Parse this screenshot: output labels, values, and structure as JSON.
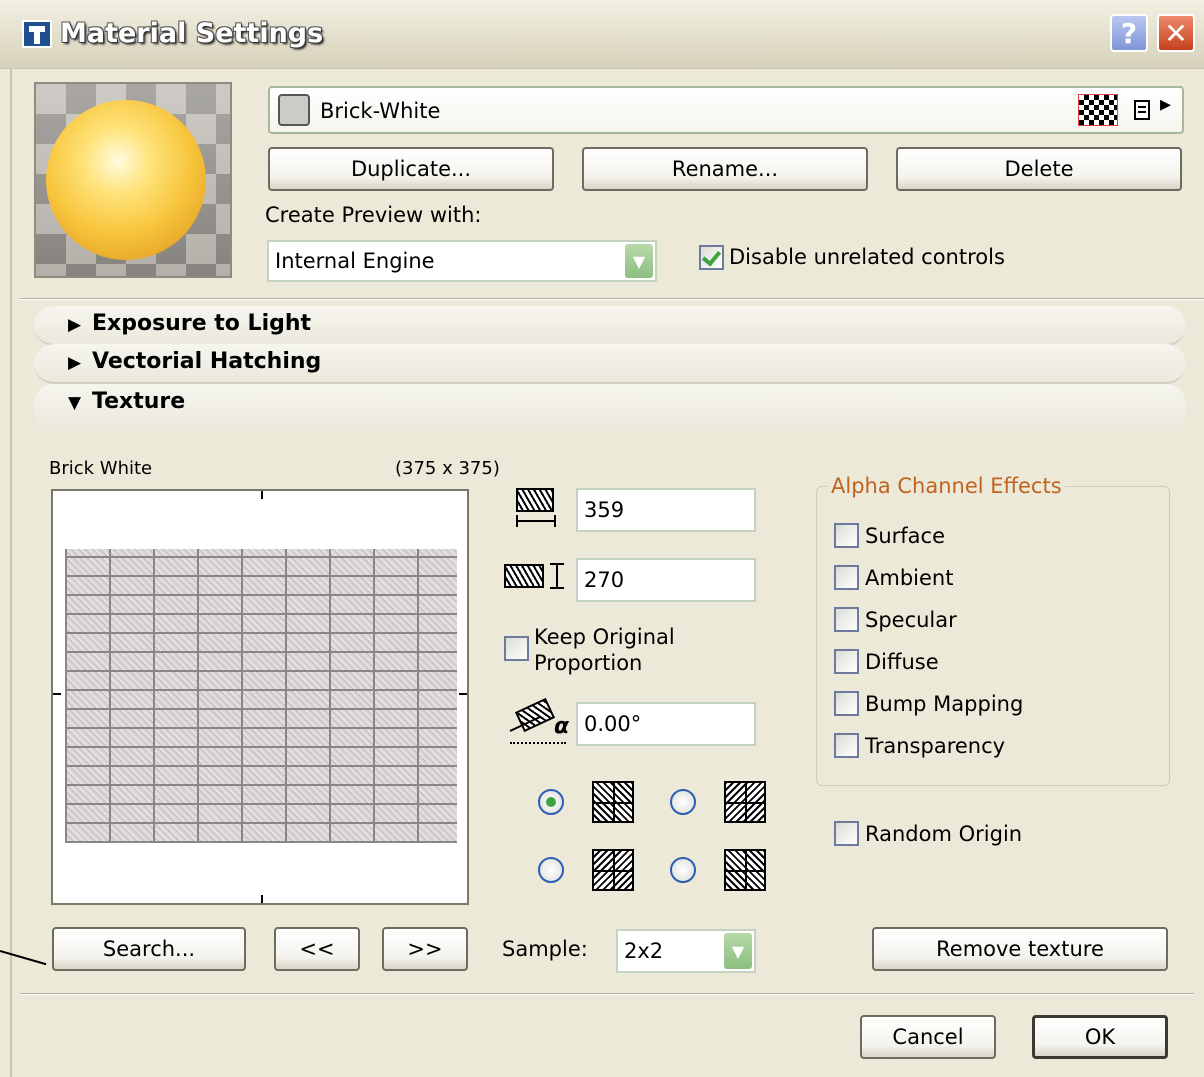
{
  "window": {
    "title": "Material Settings",
    "help_label": "?",
    "close_label": "✕"
  },
  "material": {
    "name": "Brick-White",
    "menu_arrow": "▸"
  },
  "buttons": {
    "duplicate": "Duplicate...",
    "rename": "Rename...",
    "delete": "Delete",
    "search": "Search...",
    "prev": "<<",
    "next": ">>",
    "remove_texture": "Remove texture",
    "cancel": "Cancel",
    "ok": "OK"
  },
  "preview": {
    "label": "Create Preview with:",
    "engine": "Internal Engine",
    "disable_label": "Disable unrelated controls",
    "disable_checked": true
  },
  "sections": [
    {
      "label": "Exposure to Light",
      "arrow": "▶"
    },
    {
      "label": "Vectorial Hatching",
      "arrow": "▶"
    },
    {
      "label": "Texture",
      "arrow": "▼"
    }
  ],
  "texture": {
    "name": "Brick White",
    "size": "(375 x 375)",
    "width": "359",
    "height": "270",
    "angle": "0.00°",
    "keep_proportion_line1": "Keep Original",
    "keep_proportion_line2": "Proportion",
    "sample_label": "Sample:",
    "sample_value": "2x2",
    "alpha_symbol": "α",
    "selected_pattern": 1
  },
  "alpha": {
    "title": "Alpha Channel Effects",
    "items": [
      "Surface",
      "Ambient",
      "Specular",
      "Diffuse",
      "Bump Mapping",
      "Transparency"
    ]
  },
  "random_origin": "Random Origin",
  "colors": {
    "title_text": "#ffffff",
    "group_title": "#c0631e",
    "window_bg": "#ece9d8",
    "check_green": "#3ea33e"
  }
}
